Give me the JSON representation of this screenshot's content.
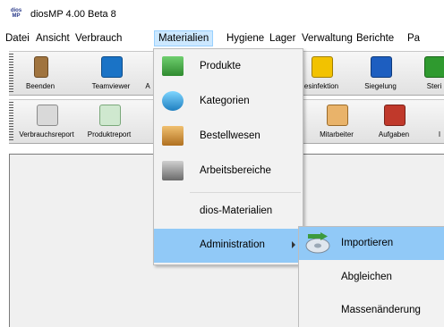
{
  "window": {
    "logo_text": "dios MP",
    "title": "diosMP  4.00 Beta 8"
  },
  "menubar": [
    {
      "label": "Datei"
    },
    {
      "label": "Ansicht"
    },
    {
      "label": "Verbrauch"
    },
    {
      "label": "Materialien"
    },
    {
      "label": "Hygiene"
    },
    {
      "label": "Lager"
    },
    {
      "label": "Verwaltung"
    },
    {
      "label": "Berichte"
    },
    {
      "label": "Pa"
    }
  ],
  "toolbar1": [
    {
      "label": "Beenden",
      "icon": "door-icon"
    },
    {
      "label": "Teamviewer",
      "icon": "teamviewer-icon"
    },
    {
      "label": "A",
      "icon": "partial-icon"
    },
    {
      "label": "esinfektion",
      "icon": "disinfection-icon"
    },
    {
      "label": "Siegelung",
      "icon": "sealing-icon"
    },
    {
      "label": "Steri",
      "icon": "sterilization-icon"
    }
  ],
  "toolbar2": [
    {
      "label": "Verbrauchsreport",
      "icon": "report-icon"
    },
    {
      "label": "Produktreport",
      "icon": "product-report-icon"
    },
    {
      "label": "Mitarbeiter",
      "icon": "employee-icon"
    },
    {
      "label": "Aufgaben",
      "icon": "tasks-icon"
    },
    {
      "label": "I",
      "icon": "partial-icon"
    }
  ],
  "dropdown": [
    {
      "label": "Produkte",
      "icon": "products-icon"
    },
    {
      "label": "Kategorien",
      "icon": "categories-icon"
    },
    {
      "label": "Bestellwesen",
      "icon": "ordering-icon"
    },
    {
      "label": "Arbeitsbereiche",
      "icon": "workspaces-icon"
    },
    {
      "label": "dios-Materialien",
      "icon": ""
    },
    {
      "label": "Administration",
      "icon": ""
    }
  ],
  "submenu": [
    {
      "label": "Importieren",
      "icon": "import-icon"
    },
    {
      "label": "Abgleichen",
      "icon": ""
    },
    {
      "label": "Massenänderung",
      "icon": ""
    }
  ],
  "colors": {
    "highlight": "#91c9f7",
    "menu_open": "#cce8ff"
  }
}
